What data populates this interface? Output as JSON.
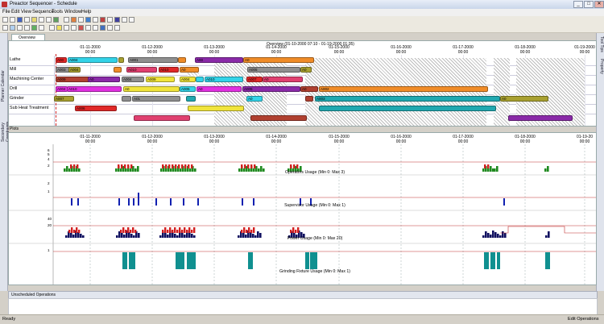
{
  "app": {
    "title": "Preactor Sequencer - Schedule"
  },
  "window_buttons": {
    "minimize": "_",
    "maximize": "□",
    "close": "✕"
  },
  "menu": [
    "File",
    "Edit",
    "View",
    "Sequence",
    "Tools",
    "Window",
    "Help"
  ],
  "side_tabs_left": [
    "Planner Calendar",
    "Secondary Constraints"
  ],
  "side_tabs_right": [
    "Tool Tips",
    "Property"
  ],
  "overview": {
    "tab_label": "Overview",
    "range": "Overview   (01-10-2000 07:10 - 01-19-2000 01:35)",
    "dates": [
      [
        "01-11-2000",
        "00:00"
      ],
      [
        "01-12-2000",
        "00:00"
      ],
      [
        "01-13-2000",
        "00:00"
      ],
      [
        "01-14-2000",
        "00:00"
      ],
      [
        "01-15-2000",
        "00:00"
      ],
      [
        "01-16-2000",
        "00:00"
      ],
      [
        "01-17-2000",
        "00:00"
      ],
      [
        "01-18-2000",
        "00:00"
      ],
      [
        "01-19-2000",
        "00:00"
      ]
    ],
    "resources": [
      "Lathe",
      "Mill",
      "Machining Center",
      "Drill",
      "Grinder",
      "Sub Heat Treatment"
    ],
    "bar_colors": {
      "cyan": "#33d3e8",
      "gray": "#8f8f8f",
      "purple": "#8a2aa8",
      "orange": "#f08c28",
      "red": "#e02828",
      "yellow": "#f0e43c",
      "magenta": "#e030e0",
      "teal": "#20a8b0",
      "olive": "#a8a030",
      "brown": "#b04030",
      "pink": "#e04070",
      "green": "#40c040",
      "blue": "#3060e0"
    },
    "bar_labels": [
      "A00",
      "A004",
      "A0",
      "A001",
      "A00",
      "A00",
      "A0",
      "A003",
      "A004",
      "A003",
      "A010",
      "A010",
      "A0",
      "A005",
      "A0",
      "A009",
      "A0",
      "A004",
      "A009",
      "A004",
      "A005",
      "A010",
      "A007",
      "A0",
      "A004",
      "A010",
      "A0",
      "A005",
      "A0",
      "A005",
      "A0",
      "A002",
      "A007",
      "A004",
      "A01",
      "A0",
      "A0",
      "A0",
      "A003",
      "A0",
      "A006"
    ]
  },
  "plots": {
    "tab_label": "Plots",
    "dates": [
      [
        "01-11-2000",
        "00:00"
      ],
      [
        "01-12-2000",
        "00:00"
      ],
      [
        "01-13-2000",
        "00:00"
      ],
      [
        "01-14-2000",
        "00:00"
      ],
      [
        "01-15-2000",
        "00:00"
      ],
      [
        "01-16-2000",
        "00:00"
      ],
      [
        "01-17-2000",
        "00:00"
      ],
      [
        "01-18-2000",
        "00:00"
      ],
      [
        "01-19-20",
        "00:00"
      ]
    ],
    "charts": [
      {
        "title": "Operators Usage (Min 0: Max 3)",
        "yticks": [
          "6",
          "5",
          "4",
          "2"
        ]
      },
      {
        "title": "Supervisor Usage (Min 0: Max 1)",
        "yticks": [
          "2",
          "1"
        ]
      },
      {
        "title": "Power Usage (Min 0: Max 20)",
        "yticks": [
          "40",
          "20"
        ]
      },
      {
        "title": "Grinding Fixture Usage (Min 0: Max 1)",
        "yticks": [
          "1"
        ]
      }
    ],
    "colors": {
      "over": "#d42020",
      "under": "#208a20",
      "blue": "#1020b0",
      "navy": "#101060",
      "teal": "#109090",
      "limit": "#c03030"
    }
  },
  "unscheduled": {
    "label": "Unscheduled Operations"
  },
  "status": {
    "left": "Ready",
    "right": "Edit Operations"
  }
}
